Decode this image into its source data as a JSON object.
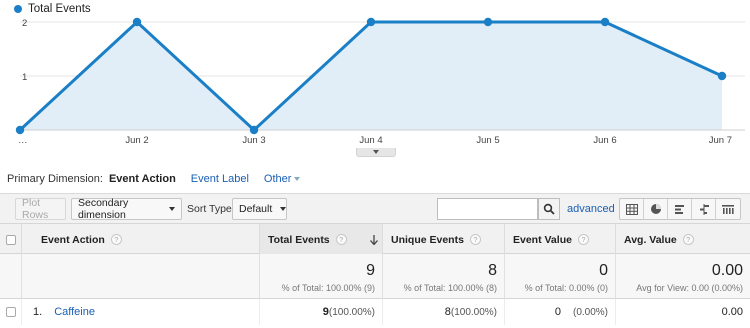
{
  "chart_data": {
    "type": "area",
    "legend": [
      {
        "name": "Total Events",
        "color": "#1a7fc6"
      }
    ],
    "series": [
      {
        "name": "Total Events",
        "values": [
          0,
          2,
          0,
          2,
          2,
          2,
          1
        ]
      }
    ],
    "x": [
      "…",
      "Jun 2",
      "Jun 3",
      "Jun 4",
      "Jun 5",
      "Jun 6",
      "Jun 7"
    ],
    "x_tick_labels": [
      "…",
      "Jun 2",
      "Jun 3",
      "Jun 4",
      "Jun 5",
      "Jun 6",
      "Jun 7"
    ],
    "y_ticks": [
      "1",
      "2"
    ],
    "ylim": [
      0,
      2
    ],
    "line_color": "#1a7fc6",
    "fill_color": "#e1eef8",
    "grid": true
  },
  "dimension_bar": {
    "label": "Primary Dimension:",
    "active": "Event Action",
    "event_label": "Event Label",
    "other": "Other"
  },
  "toolbar": {
    "plot_rows": "Plot Rows",
    "secondary_dimension": "Secondary dimension",
    "sort_type_label": "Sort Type:",
    "sort_type_value": "Default",
    "search_placeholder": "",
    "advanced": "advanced",
    "view_icons": [
      "table-view-icon",
      "pie-view-icon",
      "performance-view-icon",
      "comparison-view-icon",
      "pivot-view-icon"
    ]
  },
  "table": {
    "columns": {
      "event_action": "Event Action",
      "total_events": "Total Events",
      "unique_events": "Unique Events",
      "event_value": "Event Value",
      "avg_value": "Avg. Value"
    },
    "totals": {
      "total_events": "9",
      "total_events_sub": "% of Total: 100.00% (9)",
      "unique_events": "8",
      "unique_events_sub": "% of Total: 100.00% (8)",
      "event_value": "0",
      "event_value_sub": "% of Total: 0.00% (0)",
      "avg_value": "0.00",
      "avg_value_sub": "Avg for View: 0.00 (0.00%)"
    },
    "rows": [
      {
        "index": "1.",
        "event_action": "Caffeine",
        "total_events": "9",
        "total_events_pct": "(100.00%)",
        "unique_events": "8",
        "unique_events_pct": "(100.00%)",
        "event_value": "0",
        "event_value_pct": "(0.00%)",
        "avg_value": "0.00"
      }
    ]
  }
}
